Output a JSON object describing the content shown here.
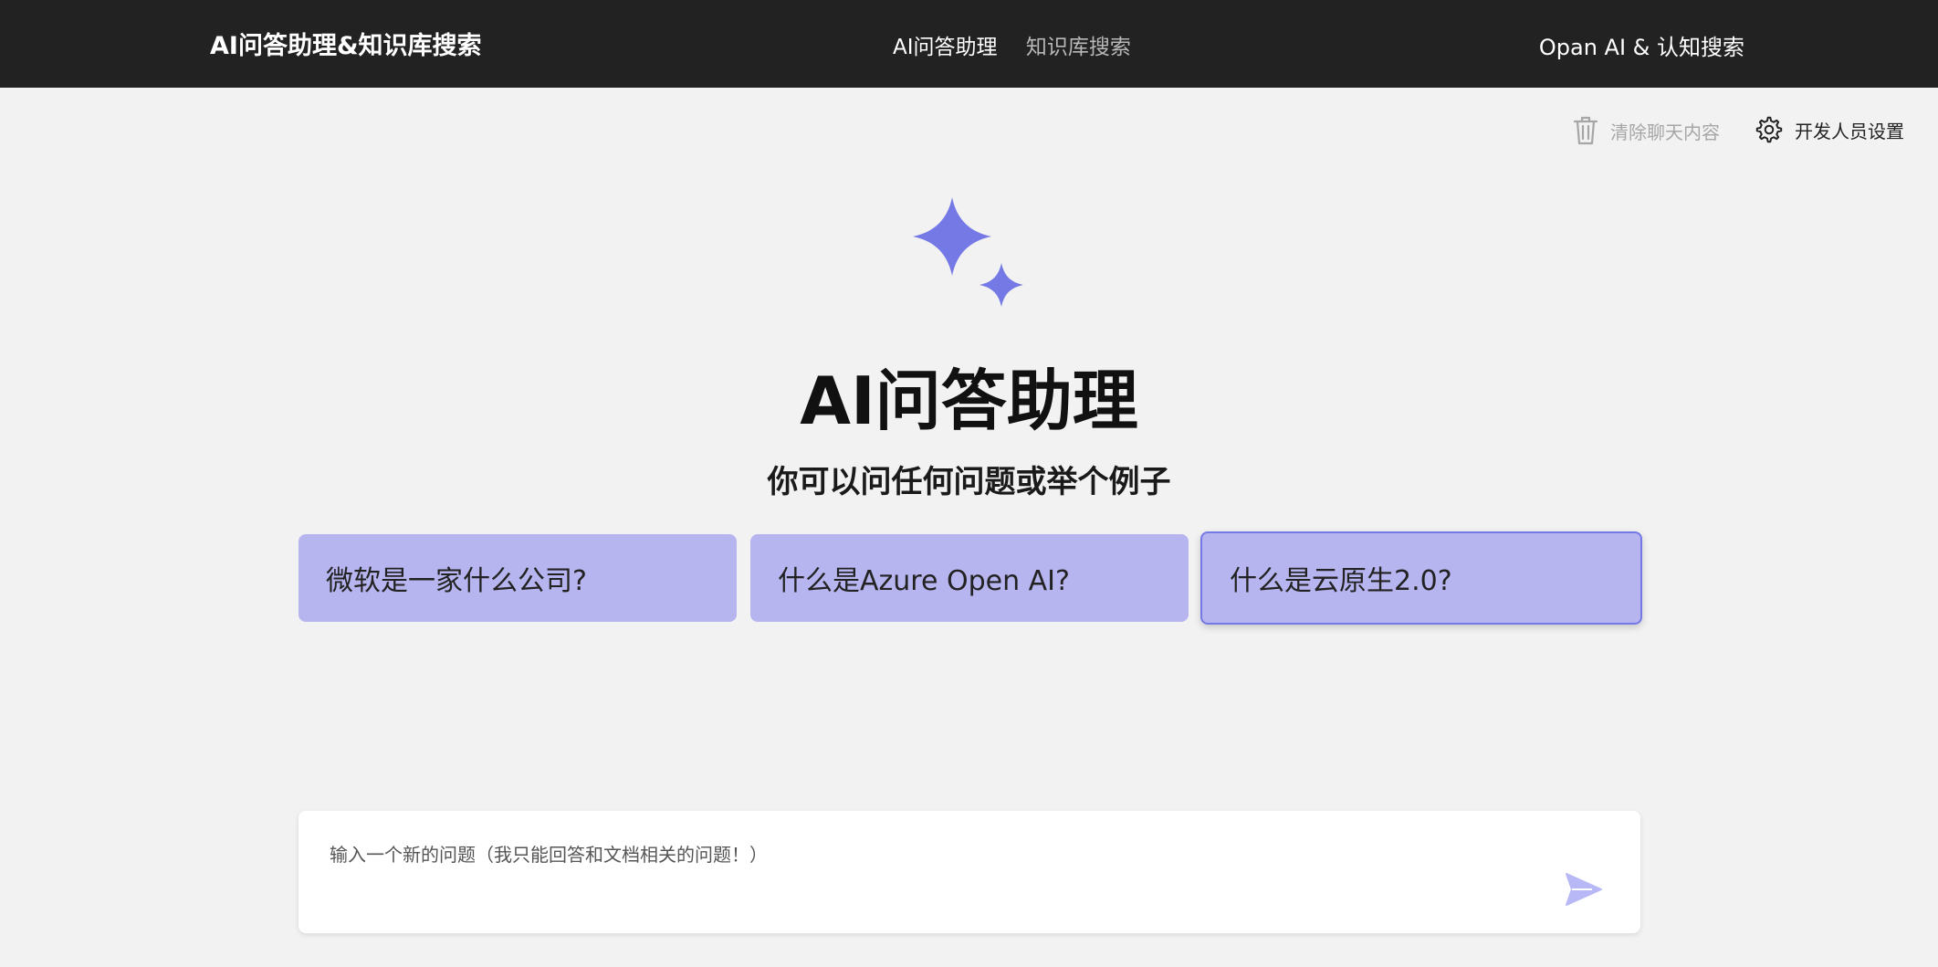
{
  "header": {
    "brand": "AI问答助理&知识库搜索",
    "nav": [
      {
        "label": "AI问答助理"
      },
      {
        "label": "知识库搜索"
      }
    ],
    "right_title": "Opan AI & 认知搜索"
  },
  "commands": {
    "clear_label": "清除聊天内容",
    "settings_label": "开发人员设置"
  },
  "hero": {
    "title": "AI问答助理",
    "subtitle": "你可以问任何问题或举个例子"
  },
  "examples": [
    {
      "text": "微软是一家什么公司?"
    },
    {
      "text": "什么是Azure Open AI?"
    },
    {
      "text": "什么是云原生2.0?"
    }
  ],
  "question_input": {
    "placeholder": "输入一个新的问题（我只能回答和文档相关的问题！）"
  },
  "icons": {
    "clear": "trash-icon",
    "settings": "gear-icon",
    "logo": "sparkle-icon",
    "send": "send-icon"
  },
  "colors": {
    "header_bg": "#222222",
    "page_bg": "#f2f2f2",
    "accent": "#7579e6",
    "example_bg": "#b7b5ef",
    "send_icon": "#b7b8f5"
  }
}
